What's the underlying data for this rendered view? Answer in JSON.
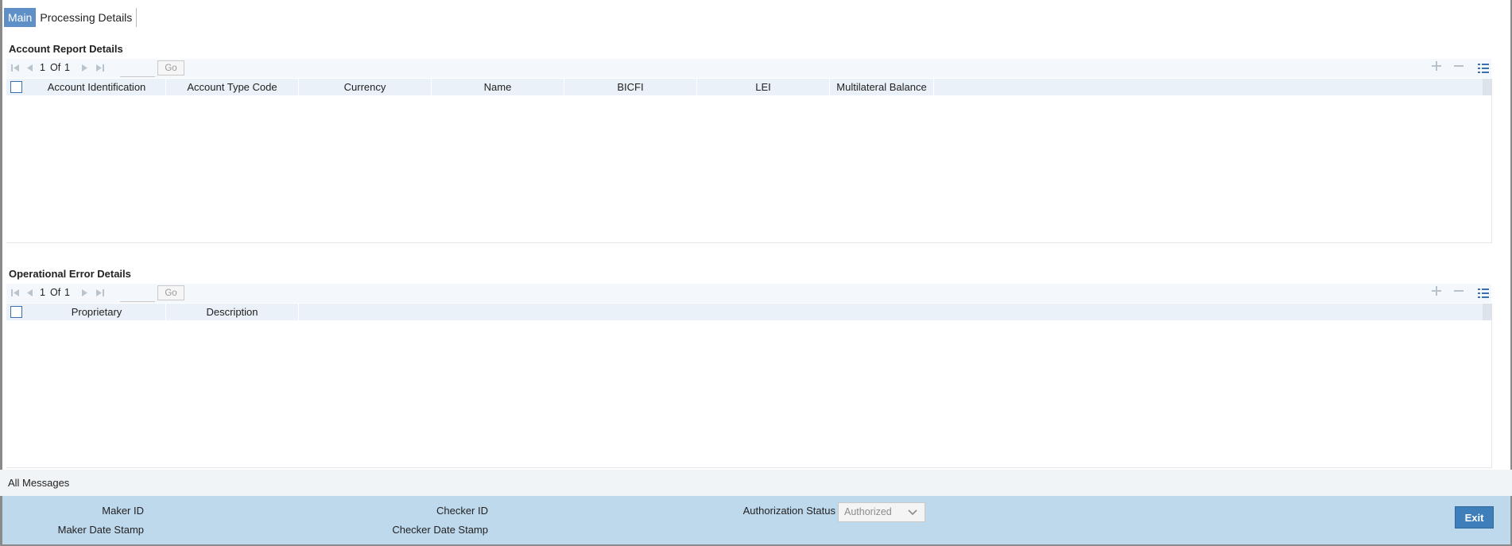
{
  "tabs": [
    {
      "label": "Main"
    },
    {
      "label": "Processing Details"
    }
  ],
  "account_report": {
    "title": "Account Report Details",
    "pager": {
      "current": "1",
      "of_label": "Of",
      "total": "1",
      "go_label": "Go"
    },
    "columns": [
      "Account Identification",
      "Account Type Code",
      "Currency",
      "Name",
      "BICFI",
      "LEI",
      "Multilateral Balance"
    ],
    "rows": []
  },
  "operational_error": {
    "title": "Operational Error Details",
    "pager": {
      "current": "1",
      "of_label": "Of",
      "total": "1",
      "go_label": "Go"
    },
    "columns": [
      "Proprietary",
      "Description"
    ],
    "rows": []
  },
  "all_messages": {
    "label": "All Messages"
  },
  "footer": {
    "maker_id_label": "Maker ID",
    "maker_date_label": "Maker Date Stamp",
    "checker_id_label": "Checker ID",
    "checker_date_label": "Checker Date Stamp",
    "auth_status_label": "Authorization Status",
    "auth_status_value": "Authorized",
    "exit_label": "Exit"
  },
  "icons": {
    "first": "first-page-icon",
    "prev": "previous-page-icon",
    "next": "next-page-icon",
    "last": "last-page-icon",
    "add": "add-row-icon",
    "remove": "remove-row-icon",
    "columns": "column-settings-icon",
    "dropdown": "chevron-down-icon"
  },
  "colors": {
    "accent": "#5e8fc6",
    "footer_bg": "#bed8ec",
    "exit_button": "#3f7fb9",
    "grid_header": "#eaf1f8"
  }
}
